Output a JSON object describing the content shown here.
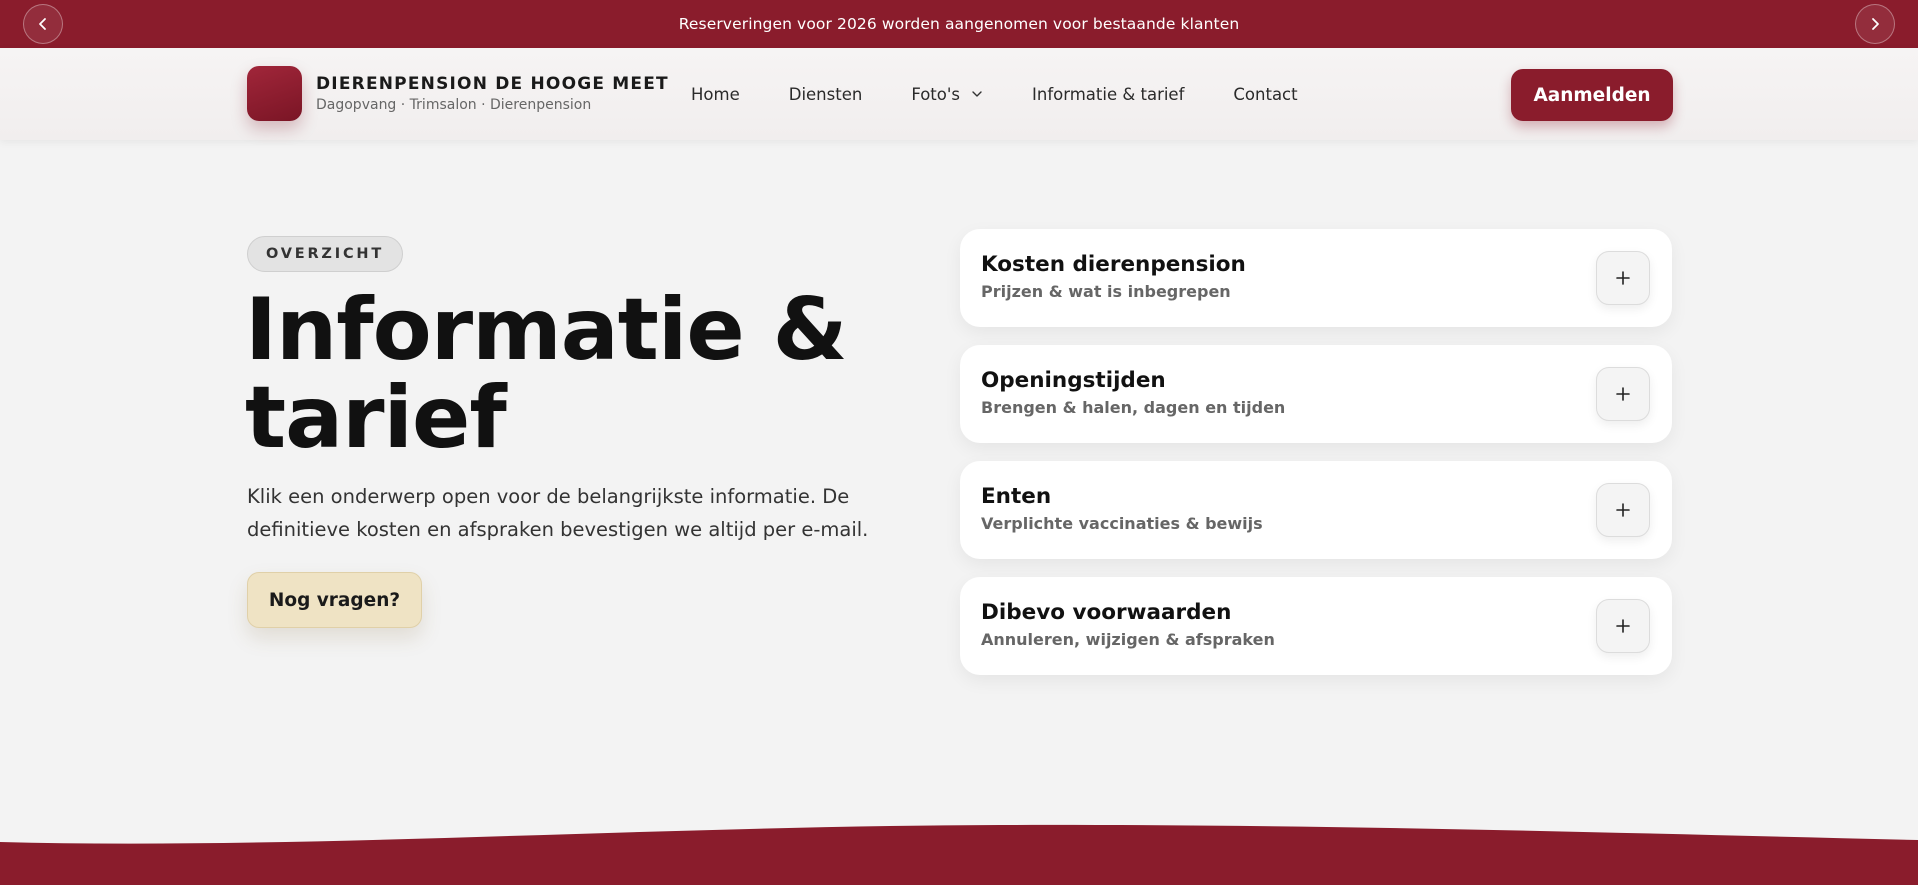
{
  "announcement": {
    "text": "Reserveringen voor 2026 worden aangenomen voor bestaande klanten",
    "prev_icon": "chevron-left-icon",
    "next_icon": "chevron-right-icon"
  },
  "header": {
    "brand_name": "DIERENPENSION DE HOOGE MEET",
    "brand_tagline": "Dagopvang · Trimsalon · Dierenpension",
    "nav": [
      {
        "label": "Home"
      },
      {
        "label": "Diensten"
      },
      {
        "label": "Foto's",
        "icon": "chevron-down-icon"
      },
      {
        "label": "Informatie & tarief"
      },
      {
        "label": "Contact"
      }
    ],
    "cta_label": "Aanmelden"
  },
  "hero": {
    "eyebrow": "OVERZICHT",
    "title_line1": "Informatie &",
    "title_line2": "tarief",
    "lead": "Klik een onderwerp open voor de belangrijkste informatie. De definitieve kosten en afspraken bevestigen we altijd per e-mail.",
    "button_label": "Nog vragen?"
  },
  "accordion": [
    {
      "title": "Kosten dierenpension",
      "subtitle": "Prijzen & wat is inbegrepen",
      "icon": "plus-icon"
    },
    {
      "title": "Openingstijden",
      "subtitle": "Brengen & halen, dagen en tijden",
      "icon": "plus-icon"
    },
    {
      "title": "Enten",
      "subtitle": "Verplichte vaccinaties & bewijs",
      "icon": "plus-icon"
    },
    {
      "title": "Dibevo voorwaarden",
      "subtitle": "Annuleren, wijzigen & afspraken",
      "icon": "plus-icon"
    }
  ],
  "colors": {
    "brand": "#8a1c2c",
    "background": "#f3f3f3",
    "secondary_button": "#efe3c4"
  }
}
